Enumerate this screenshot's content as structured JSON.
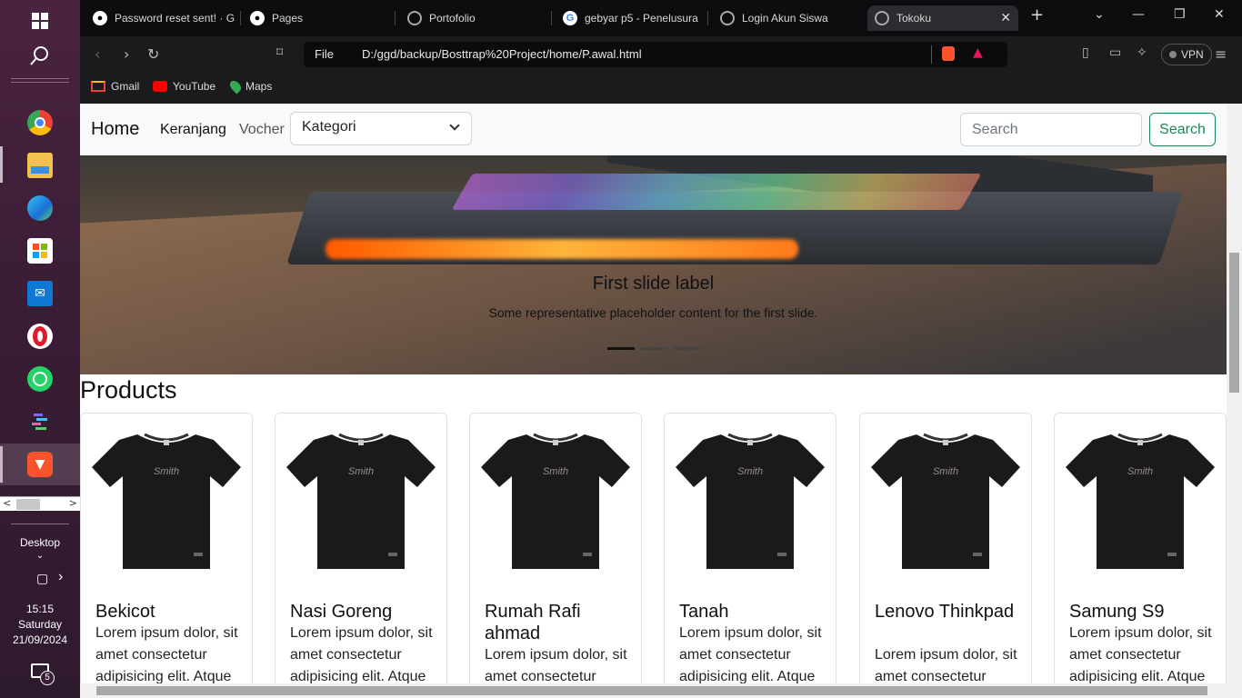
{
  "taskbar": {
    "desktop_label": "Desktop",
    "time": "15:15",
    "day": "Saturday",
    "date": "21/09/2024",
    "notification_count": "5"
  },
  "tabs": [
    {
      "label": "Password reset sent! · G",
      "icon": "github-icon"
    },
    {
      "label": "Pages",
      "icon": "github-icon"
    },
    {
      "label": "Portofolio",
      "icon": "globe-icon"
    },
    {
      "label": "gebyar p5 - Penelusura",
      "icon": "google-icon"
    },
    {
      "label": "Login Akun Siswa",
      "icon": "globe-icon"
    },
    {
      "label": "Tokoku",
      "icon": "globe-icon"
    }
  ],
  "toolbar": {
    "url_scheme_label": "File",
    "url": "D:/ggd/backup/Bosttrap%20Project/home/P.awal.html",
    "vpn_label": "VPN"
  },
  "bookmarks": [
    {
      "label": "Gmail",
      "icon": "gmail-icon"
    },
    {
      "label": "YouTube",
      "icon": "youtube-icon"
    },
    {
      "label": "Maps",
      "icon": "maps-icon"
    }
  ],
  "page": {
    "brand": "Home",
    "nav_links": [
      "Keranjang",
      "Vocher"
    ],
    "select_value": "Kategori",
    "search_placeholder": "Search",
    "search_button": "Search",
    "carousel": {
      "caption_title": "First slide label",
      "caption_text": "Some representative placeholder content for the first slide."
    },
    "products_title": "Products",
    "shirt_print": "Smith",
    "products": [
      {
        "title": "Bekicot",
        "text": "Lorem ipsum dolor, sit amet consectetur adipisicing elit. Atque"
      },
      {
        "title": "Nasi Goreng",
        "text": "Lorem ipsum dolor, sit amet consectetur adipisicing elit. Atque"
      },
      {
        "title": "Rumah Rafi ahmad",
        "text": "Lorem ipsum dolor, sit amet consectetur adipisicing elit. Atque"
      },
      {
        "title": "Tanah",
        "text": "Lorem ipsum dolor, sit amet consectetur adipisicing elit. Atque"
      },
      {
        "title": "Lenovo Thinkpad",
        "text": "Lorem ipsum dolor, sit amet consectetur adipisicing elit. Atque"
      },
      {
        "title": "Samung S9",
        "text": "Lorem ipsum dolor, sit amet consectetur adipisicing elit. Atque"
      }
    ]
  },
  "colors": {
    "accent_green": "#198754",
    "navbar_bg": "#f8f9fa"
  }
}
